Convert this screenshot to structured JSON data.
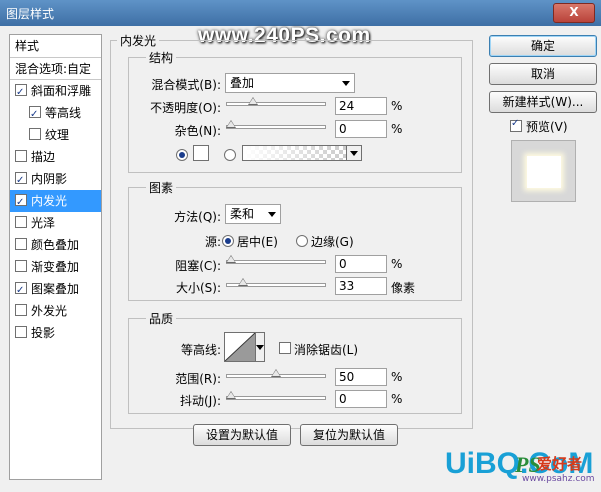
{
  "window": {
    "title": "图层样式",
    "close": "X"
  },
  "watermark": "www.240PS.com",
  "style_list": {
    "header": "样式",
    "blend_options": "混合选项:自定",
    "items": [
      {
        "label": "斜面和浮雕",
        "checked": true,
        "sub": false,
        "selected": false
      },
      {
        "label": "等高线",
        "checked": true,
        "sub": true,
        "selected": false
      },
      {
        "label": "纹理",
        "checked": false,
        "sub": true,
        "selected": false
      },
      {
        "label": "描边",
        "checked": false,
        "sub": false,
        "selected": false
      },
      {
        "label": "内阴影",
        "checked": true,
        "sub": false,
        "selected": false
      },
      {
        "label": "内发光",
        "checked": true,
        "sub": false,
        "selected": true
      },
      {
        "label": "光泽",
        "checked": false,
        "sub": false,
        "selected": false
      },
      {
        "label": "颜色叠加",
        "checked": false,
        "sub": false,
        "selected": false
      },
      {
        "label": "渐变叠加",
        "checked": false,
        "sub": false,
        "selected": false
      },
      {
        "label": "图案叠加",
        "checked": true,
        "sub": false,
        "selected": false
      },
      {
        "label": "外发光",
        "checked": false,
        "sub": false,
        "selected": false
      },
      {
        "label": "投影",
        "checked": false,
        "sub": false,
        "selected": false
      }
    ]
  },
  "panel": {
    "title": "内发光",
    "structure": {
      "legend": "结构",
      "blend_mode_label": "混合模式(B):",
      "blend_mode_value": "叠加",
      "opacity_label": "不透明度(O):",
      "opacity_value": "24",
      "opacity_fraction": 0.24,
      "noise_label": "杂色(N):",
      "noise_value": "0",
      "noise_fraction": 0,
      "unit": "%"
    },
    "elements": {
      "legend": "图素",
      "method_label": "方法(Q):",
      "method_value": "柔和",
      "source_label": "源:",
      "source_center": "居中(E)",
      "source_edge": "边缘(G)",
      "choke_label": "阻塞(C):",
      "choke_value": "0",
      "choke_fraction": 0,
      "size_label": "大小(S):",
      "size_value": "33",
      "size_fraction": 0.132,
      "unit_pct": "%",
      "unit_px": "像素"
    },
    "quality": {
      "legend": "品质",
      "contour_label": "等高线:",
      "antialias_label": "消除锯齿(L)",
      "range_label": "范围(R):",
      "range_value": "50",
      "range_fraction": 0.5,
      "jitter_label": "抖动(J):",
      "jitter_value": "0",
      "jitter_fraction": 0,
      "unit": "%"
    },
    "set_default": "设置为默认值",
    "reset_default": "复位为默认值"
  },
  "buttons": {
    "ok": "确定",
    "cancel": "取消",
    "new_style": "新建样式(W)...",
    "preview_label": "预览(V)"
  },
  "logo": {
    "text": "UiBQ.CoM",
    "ps": "PS",
    "cn": "爱好者",
    "url": "www.psahz.com"
  }
}
